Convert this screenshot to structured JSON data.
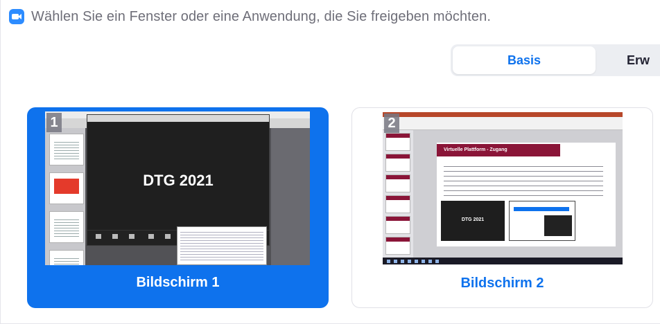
{
  "header": {
    "title": "Wählen Sie ein Fenster oder eine Anwendung, die Sie freigeben möchten.",
    "icon": "zoom-camera-icon"
  },
  "tabs": [
    {
      "label": "Basis",
      "active": true
    },
    {
      "label": "Erw",
      "active": false
    }
  ],
  "screens": [
    {
      "number": "1",
      "label": "Bildschirm 1",
      "selected": true,
      "preview_text": "DTG 2021"
    },
    {
      "number": "2",
      "label": "Bildschirm 2",
      "selected": false,
      "preview_heading": "Virtuelle Plattform - Zugang",
      "preview_text": "DTG 2021"
    }
  ],
  "colors": {
    "accent": "#0e72ed",
    "selected_card": "#0e72ed",
    "header_text": "#6e6e78",
    "slide_header": "#8a1538"
  }
}
